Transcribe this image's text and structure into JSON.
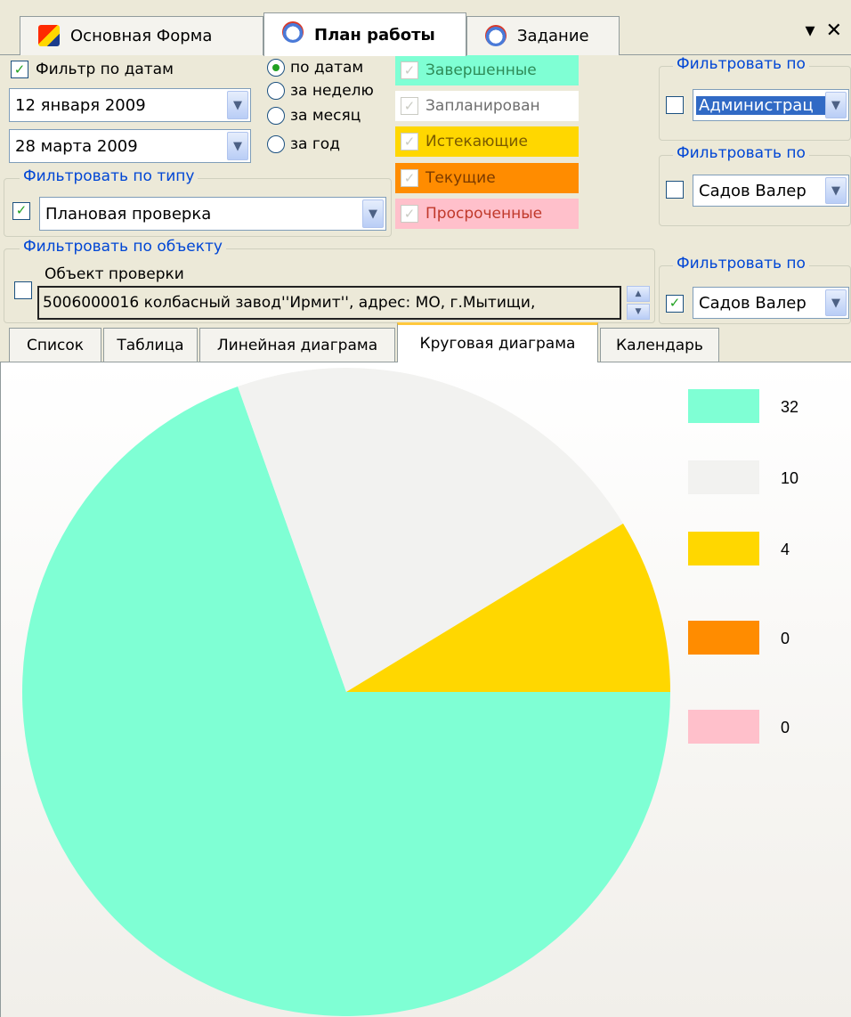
{
  "doc_tabs": [
    {
      "label": "Основная Форма",
      "icon": "app-form-icon"
    },
    {
      "label": "План работы",
      "icon": "alarm-clock-icon"
    },
    {
      "label": "Задание",
      "icon": "alarm-clock-icon"
    }
  ],
  "window_buttons": {
    "dropdown": "▾",
    "close": "✕"
  },
  "filters": {
    "date_filter_label": "Фильтр по датам",
    "date_from": "12  января  2009",
    "date_to": "28   марта  2009",
    "radios": [
      "по датам",
      "за неделю",
      "за месяц",
      "за год"
    ],
    "type_group_title": "Фильтровать по типу",
    "type_value": "Плановая проверка",
    "object_group_title": "Фильтровать по объекту",
    "object_label": "Объект проверки",
    "object_value": "5006000016  колбасный завод''Ирмит'', адрес: МО, г.Мытищи,",
    "right_groups": [
      {
        "title": "Фильтровать по",
        "value": "Администрац"
      },
      {
        "title": "Фильтровать по",
        "value": "Садов Валер"
      },
      {
        "title": "Фильтровать по",
        "value": "Садов Валер"
      }
    ]
  },
  "statuses": [
    {
      "label": "Завершенные",
      "bg": "#7FFFD4",
      "fg": "#2E8B57"
    },
    {
      "label": "Запланирован",
      "bg": "#FFFFFF",
      "fg": "#6E6E6E"
    },
    {
      "label": "Истекающие",
      "bg": "#FFD700",
      "fg": "#7A5A00"
    },
    {
      "label": "Текущие",
      "bg": "#FF8C00",
      "fg": "#7A3A00"
    },
    {
      "label": "Просроченные",
      "bg": "#FFC0CB",
      "fg": "#C0392B"
    }
  ],
  "view_tabs": [
    "Список",
    "Таблица",
    "Линейная диаграма",
    "Круговая диаграма",
    "Календарь"
  ],
  "chart_data": {
    "type": "pie",
    "values": [
      32,
      10,
      4,
      0,
      0
    ],
    "colors": [
      "#7FFFD4",
      "#F2F2F0",
      "#FFD700",
      "#FF8C00",
      "#FFC0CB"
    ],
    "legend": [
      {
        "color": "#7FFFD4",
        "value": "32"
      },
      {
        "color": "#F2F2F0",
        "value": "10"
      },
      {
        "color": "#FFD700",
        "value": "4"
      },
      {
        "color": "#FF8C00",
        "value": "0"
      },
      {
        "color": "#FFC0CB",
        "value": "0"
      }
    ]
  }
}
